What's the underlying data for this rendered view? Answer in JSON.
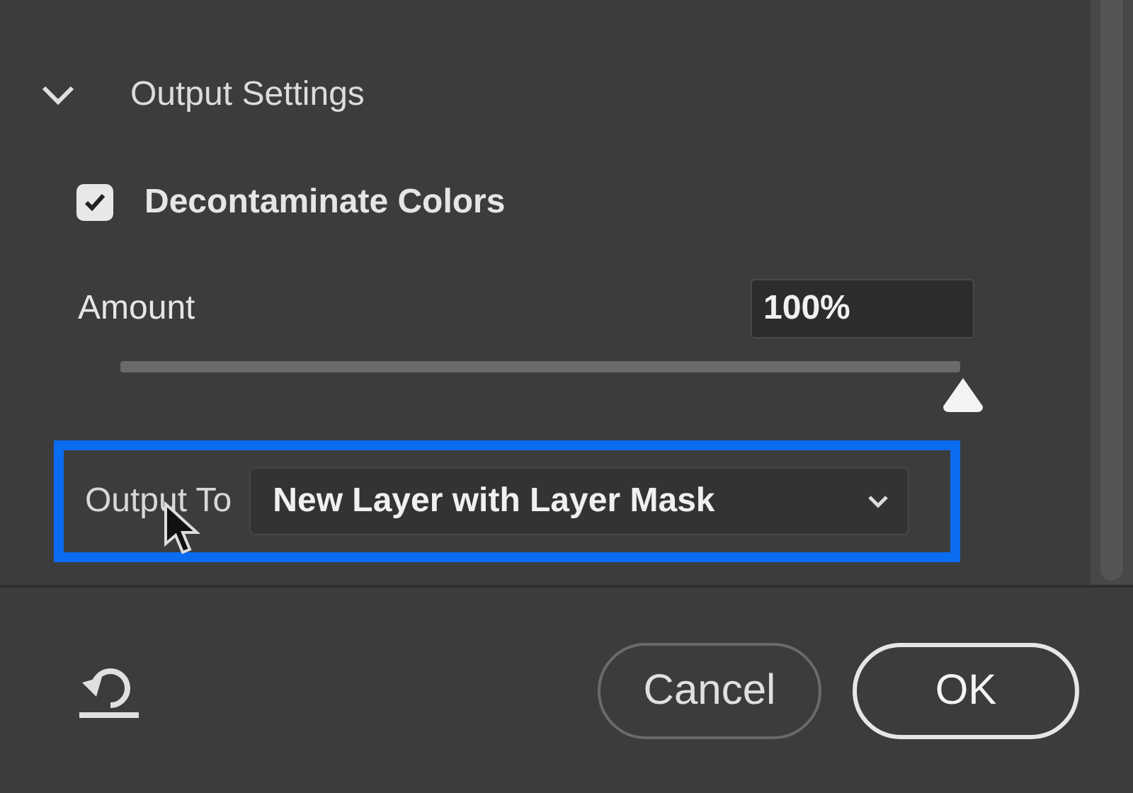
{
  "section": {
    "title": "Output Settings",
    "expanded": true
  },
  "decontaminate": {
    "label": "Decontaminate Colors",
    "checked": true
  },
  "amount": {
    "label": "Amount",
    "value": "100%",
    "level": 1
  },
  "output_to": {
    "label": "Output To",
    "value": "New Layer with Layer Mask",
    "highlighted": true
  },
  "buttons": [
    {
      "label": "Cancel",
      "kind": "secondary"
    },
    {
      "label": "OK",
      "kind": "primary"
    }
  ]
}
